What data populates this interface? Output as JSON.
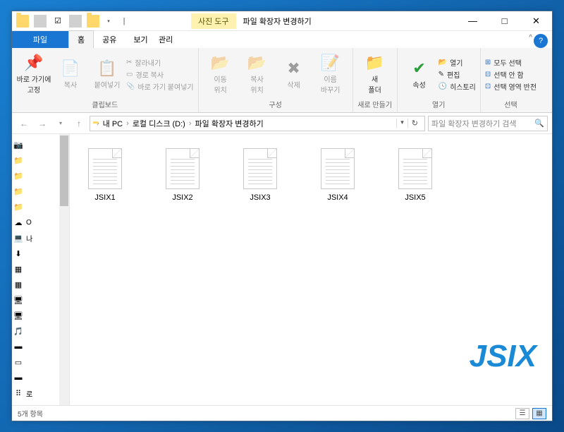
{
  "window": {
    "qat_path": "|",
    "tool_tab": "사진 도구",
    "title": "파일 확장자 변경하기",
    "min": "—",
    "max": "□",
    "close": "✕"
  },
  "tabs": {
    "file": "파일",
    "home": "홈",
    "share": "공유",
    "view": "보기",
    "ctx": "관리",
    "expand": "^",
    "help": "?"
  },
  "ribbon": {
    "pin": "바로 가기에\n고정",
    "copy": "복사",
    "paste": "붙여넣기",
    "cut": "잘라내기",
    "copypath": "경로 복사",
    "pasteshort": "바로 가기 붙여넣기",
    "clipboard": "클립보드",
    "moveto": "이동\n위치",
    "copyto": "복사\n위치",
    "delete": "삭제",
    "rename": "이름\n바꾸기",
    "organize": "구성",
    "newfolder": "새\n폴더",
    "newitem": "새로 만들기",
    "properties": "속성",
    "open1": "열기",
    "open2": "편집",
    "open3": "히스토리",
    "open_label": "열기",
    "selectall": "모두 선택",
    "selectnone": "선택 안 함",
    "selectinv": "선택 영역 반전",
    "select_label": "선택"
  },
  "addr": {
    "back": "←",
    "fwd": "→",
    "up": "↑",
    "icon": "📁",
    "root": "내 PC",
    "drive": "로컬 디스크 (D:)",
    "folder": "파일 확장자 변경하기",
    "refresh": "↻",
    "search_placeholder": "파일 확장자 변경하기 검색",
    "search_icon": "🔍"
  },
  "nav": {
    "items": [
      {
        "ic": "📷",
        "label": ""
      },
      {
        "ic": "📁",
        "label": ""
      },
      {
        "ic": "📁",
        "label": ""
      },
      {
        "ic": "📁",
        "label": ""
      },
      {
        "ic": "📁",
        "label": ""
      },
      {
        "ic": "☁",
        "label": "O"
      },
      {
        "ic": "💻",
        "label": "나"
      },
      {
        "ic": "⬇",
        "label": ""
      },
      {
        "ic": "▦",
        "label": ""
      },
      {
        "ic": "▦",
        "label": ""
      },
      {
        "ic": "🖥",
        "label": ""
      },
      {
        "ic": "🖥",
        "label": ""
      },
      {
        "ic": "🎵",
        "label": ""
      },
      {
        "ic": "▬",
        "label": ""
      },
      {
        "ic": "▭",
        "label": ""
      },
      {
        "ic": "▬",
        "label": ""
      },
      {
        "ic": "⠿",
        "label": "로"
      }
    ]
  },
  "files": [
    {
      "name": "JSIX1"
    },
    {
      "name": "JSIX2"
    },
    {
      "name": "JSIX3"
    },
    {
      "name": "JSIX4"
    },
    {
      "name": "JSIX5"
    }
  ],
  "watermark": "JSIX",
  "status": {
    "count": "5개 항목"
  }
}
